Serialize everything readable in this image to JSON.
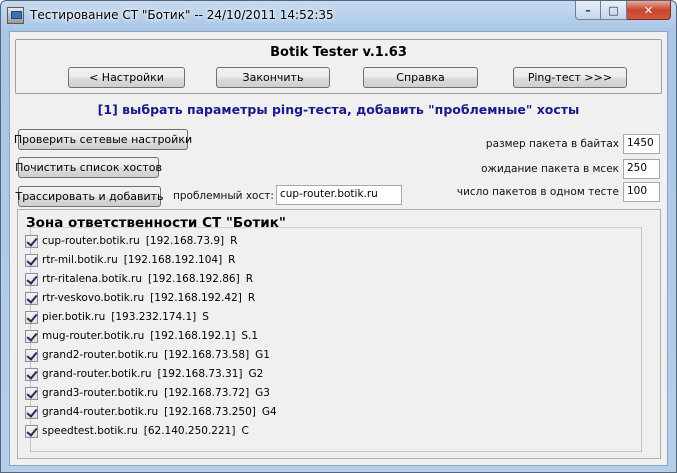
{
  "window": {
    "title": "Тестирование СТ \"Ботик\" -- 24/10/2011 14:52:35",
    "controls": {
      "minimize": "–",
      "maximize": "□",
      "close": "✕"
    }
  },
  "app": {
    "title": "Botik Tester v.1.63",
    "nav_buttons": [
      "< Настройки",
      "Закончить",
      "Справка",
      "Ping-тест >>>"
    ],
    "instruction": "[1] выбрать параметры ping-теста, добавить \"проблемные\" хосты"
  },
  "actions": {
    "check_network": "Проверить сетевые настройки",
    "clear_hosts": "Почистить список хостов",
    "trace_add": "Трассировать и добавить"
  },
  "problem_host": {
    "label": "проблемный хост:",
    "value": "cup-router.botik.ru"
  },
  "params": {
    "packet_size_label": "размер пакета в байтах",
    "packet_size": "1450",
    "packet_wait_label": "ожидание пакета в мсек",
    "packet_wait": "250",
    "packets_per_test_label": "число пакетов в одном тесте",
    "packets_per_test": "100"
  },
  "zone": {
    "title": "Зона ответственности СТ \"Ботик\"",
    "hosts": [
      {
        "name": "cup-router.botik.ru",
        "ip": "[192.168.73.9]",
        "tag": "R",
        "checked": true
      },
      {
        "name": "rtr-mil.botik.ru",
        "ip": "[192.168.192.104]",
        "tag": "R",
        "checked": true
      },
      {
        "name": "rtr-ritalena.botik.ru",
        "ip": "[192.168.192.86]",
        "tag": "R",
        "checked": true
      },
      {
        "name": "rtr-veskovo.botik.ru",
        "ip": "[192.168.192.42]",
        "tag": "R",
        "checked": true
      },
      {
        "name": "pier.botik.ru",
        "ip": "[193.232.174.1]",
        "tag": "S",
        "checked": true
      },
      {
        "name": "mug-router.botik.ru",
        "ip": "[192.168.192.1]",
        "tag": "S.1",
        "checked": true
      },
      {
        "name": "grand2-router.botik.ru",
        "ip": "[192.168.73.58]",
        "tag": "G1",
        "checked": true
      },
      {
        "name": "grand-router.botik.ru",
        "ip": "[192.168.73.31]",
        "tag": "G2",
        "checked": true
      },
      {
        "name": "grand3-router.botik.ru",
        "ip": "[192.168.73.72]",
        "tag": "G3",
        "checked": true
      },
      {
        "name": "grand4-router.botik.ru",
        "ip": "[192.168.73.250]",
        "tag": "G4",
        "checked": true
      },
      {
        "name": "speedtest.botik.ru",
        "ip": "[62.140.250.221]",
        "tag": "C",
        "checked": true
      }
    ]
  }
}
